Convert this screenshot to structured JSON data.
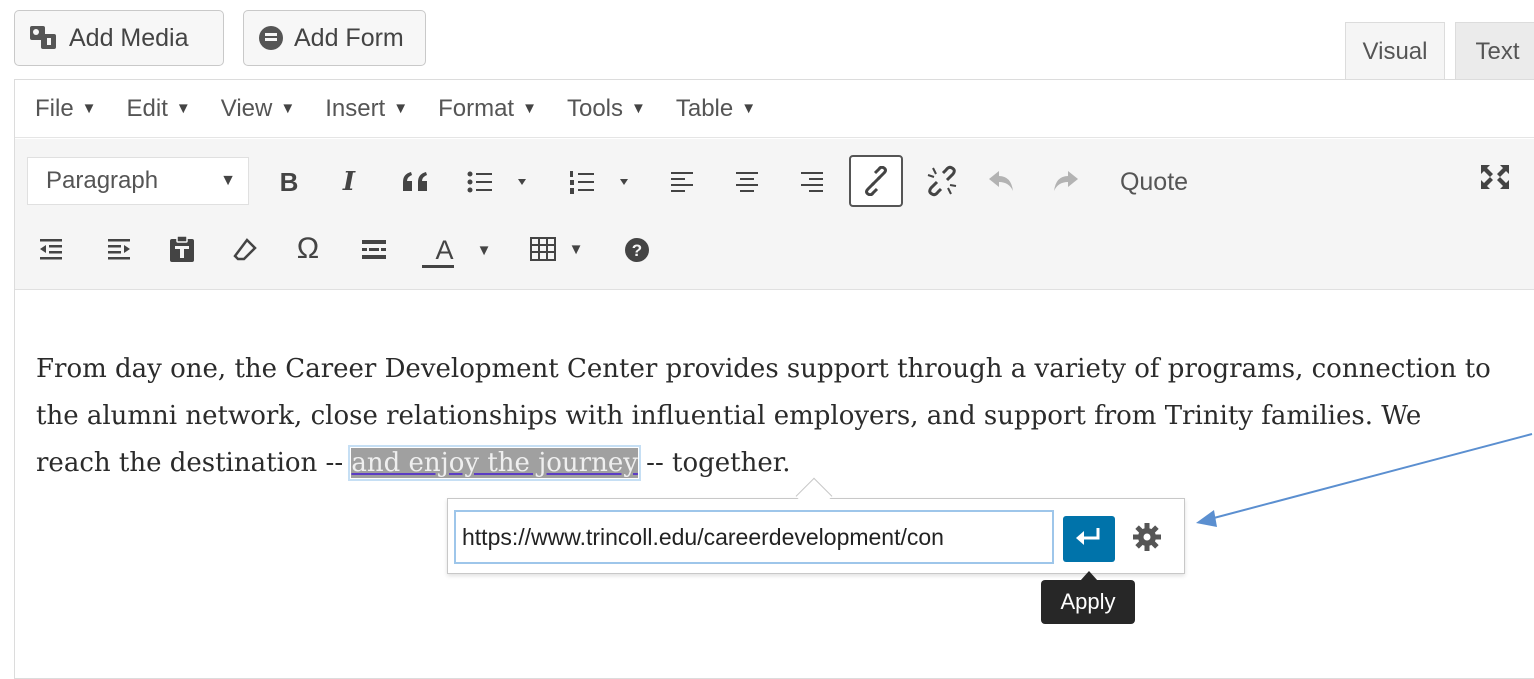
{
  "media_buttons": {
    "add_media": "Add Media",
    "add_form": "Add Form"
  },
  "tabs": {
    "visual": "Visual",
    "text": "Text"
  },
  "menubar": [
    {
      "label": "File"
    },
    {
      "label": "Edit"
    },
    {
      "label": "View"
    },
    {
      "label": "Insert"
    },
    {
      "label": "Format"
    },
    {
      "label": "Tools"
    },
    {
      "label": "Table"
    }
  ],
  "toolbar": {
    "format_select": "Paragraph",
    "quote_label": "Quote",
    "icons": [
      "bold-icon",
      "italic-icon",
      "blockquote-icon",
      "bullet-list-icon",
      "numbered-list-icon",
      "align-left-icon",
      "align-center-icon",
      "align-right-icon",
      "link-icon",
      "unlink-icon",
      "undo-icon",
      "redo-icon",
      "fullscreen-icon",
      "outdent-icon",
      "indent-icon",
      "paste-text-icon",
      "clear-format-icon",
      "special-char-icon",
      "read-more-icon",
      "text-color-icon",
      "table-icon",
      "help-icon"
    ],
    "bold_glyph": "B",
    "italic_glyph": "I",
    "omega_glyph": "Ω",
    "text_color_glyph": "A",
    "help_glyph": "?"
  },
  "content": {
    "before_selection": "From day one, the Career Development Center provides support through a variety of programs, connection to the alumni network, close relationships with influential employers, and support from Trinity families. We reach the destination -- ",
    "selection": "and enjoy the journey",
    "after_selection": " -- together."
  },
  "link_popup": {
    "url_value": "https://www.trincoll.edu/careerdevelopment/con",
    "apply_tooltip": "Apply"
  },
  "colors": {
    "accent": "#0073aa",
    "annotation_arrow": "#5b8fd0",
    "selection_bg": "#a0a0a0"
  }
}
